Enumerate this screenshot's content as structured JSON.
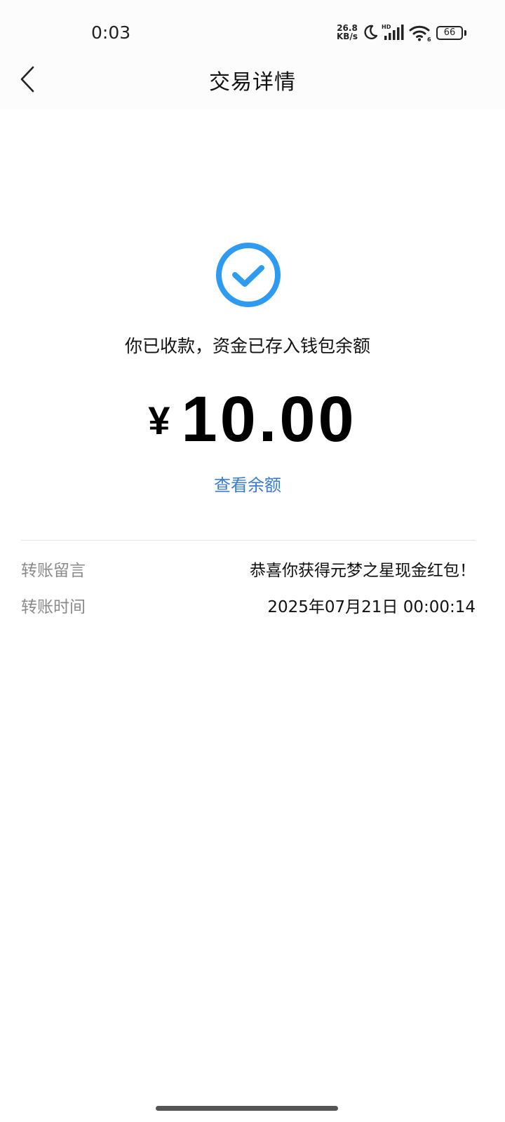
{
  "status_bar": {
    "time": "0:03",
    "net_speed_value": "26.8",
    "net_speed_unit": "KB/s",
    "signal_label": "HD",
    "wifi_label": "6",
    "battery": "66"
  },
  "header": {
    "title": "交易详情",
    "back_icon": "chevron-left-icon"
  },
  "transaction": {
    "status_icon": "check-circle-icon",
    "message": "你已收款，资金已存入钱包余额",
    "currency": "¥",
    "amount": "10.00",
    "view_balance_label": "查看余额"
  },
  "details": [
    {
      "label": "转账留言",
      "value": "恭喜你获得元梦之星现金红包！"
    },
    {
      "label": "转账时间",
      "value": "2025年07月21日 00:00:14"
    }
  ],
  "colors": {
    "accent": "#2e9bf0",
    "link": "#3a7bd5",
    "label_gray": "#8a8a8a"
  }
}
